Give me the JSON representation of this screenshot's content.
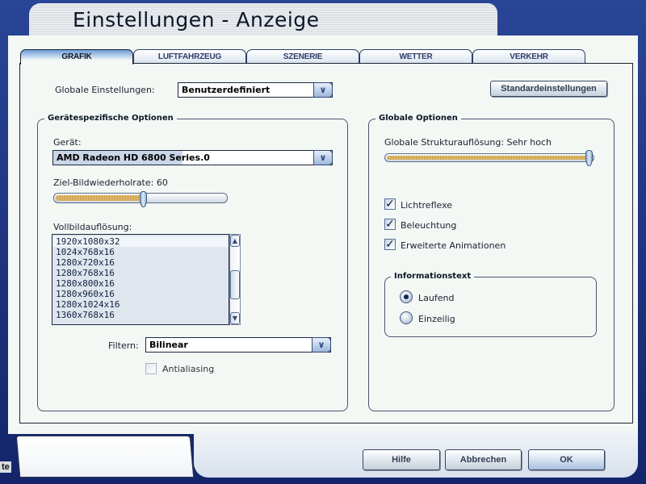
{
  "window": {
    "title": "Einstellungen - Anzeige"
  },
  "tabs": [
    {
      "label": "GRAFIK",
      "active": true
    },
    {
      "label": "LUFTFAHRZEUG"
    },
    {
      "label": "SZENERIE"
    },
    {
      "label": "WETTER"
    },
    {
      "label": "VERKEHR"
    }
  ],
  "global_settings": {
    "label": "Globale Einstellungen:",
    "value": "Benutzerdefiniert",
    "defaults_button": "Standardeinstellungen"
  },
  "device_group": {
    "title": "Gerätespezifische Optionen",
    "device_label": "Gerät:",
    "device_value": "AMD Radeon HD 6800 Series.0",
    "refresh_label": "Ziel-Bildwiederholrate: 60",
    "refresh_fraction": 0.52,
    "resolution_label": "Vollbildauflösung:",
    "resolutions": [
      "1920x1080x32",
      "1024x768x16",
      "1280x720x16",
      "1280x768x16",
      "1280x800x16",
      "1280x960x16",
      "1280x1024x16",
      "1360x768x16"
    ],
    "filter_label": "Filtern:",
    "filter_value": "Bilinear",
    "antialiasing_label": "Antialiasing",
    "antialiasing_checked": false
  },
  "global_group": {
    "title": "Globale Optionen",
    "texture_label": "Globale Strukturauflösung: Sehr hoch",
    "texture_fraction": 1.0,
    "checkboxes": [
      {
        "label": "Lichtreflexe",
        "checked": true
      },
      {
        "label": "Beleuchtung",
        "checked": true
      },
      {
        "label": "Erweiterte Animationen",
        "checked": true
      }
    ],
    "info_title": "Informationstext",
    "radios": [
      {
        "label": "Laufend",
        "selected": true
      },
      {
        "label": "Einzeilig",
        "selected": false
      }
    ]
  },
  "footer": {
    "help": "Hilfe",
    "cancel": "Abbrechen",
    "ok": "OK",
    "edge_text": "te"
  },
  "icons": {
    "combo_arrow": "∨",
    "check": "✓",
    "scroll_up": "▲",
    "scroll_down": "▼"
  }
}
